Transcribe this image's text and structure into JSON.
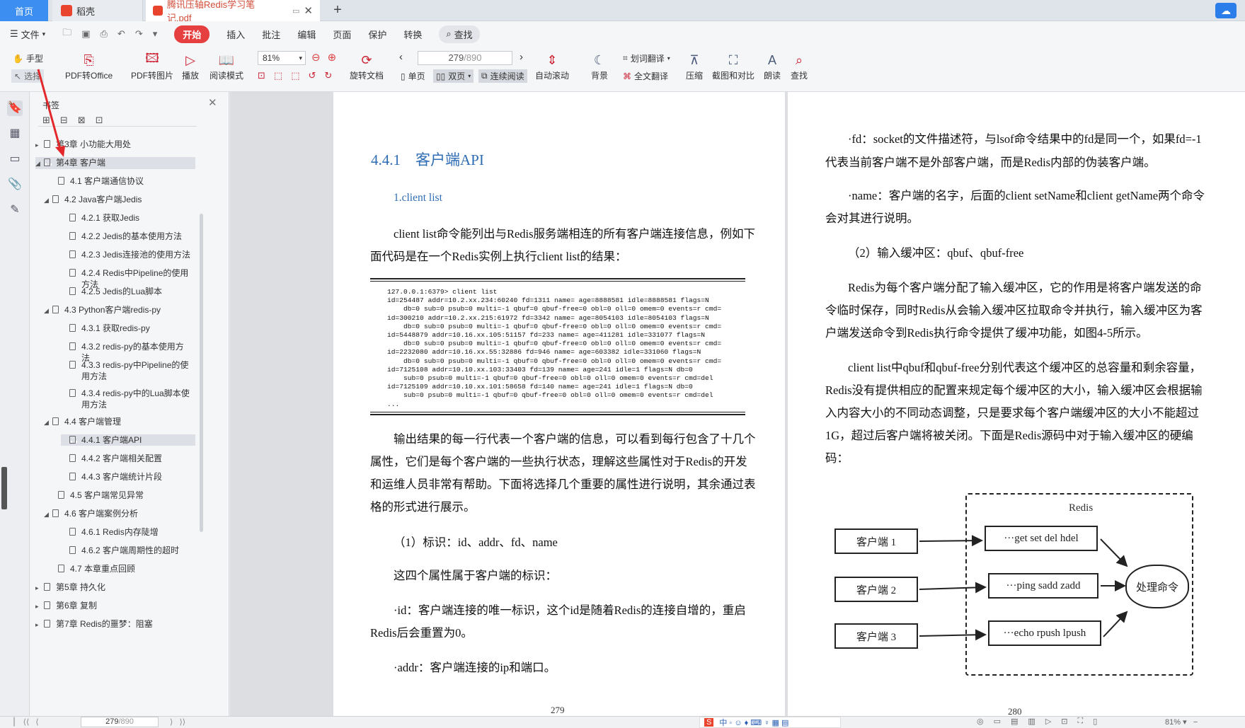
{
  "tabs": {
    "home": "首页",
    "daoke": "稻壳",
    "doc": "腾讯压轴Redis学习笔记.pdf"
  },
  "menu": [
    "文件",
    "开始",
    "插入",
    "批注",
    "编辑",
    "页面",
    "保护",
    "转换",
    "查找"
  ],
  "toolbar": {
    "hand": "手型",
    "select": "选择",
    "pdf_to_office": "PDF转Office",
    "pdf_to_image": "PDF转图片",
    "play": "播放",
    "read_mode": "阅读模式",
    "zoom": "81%",
    "rotate": "旋转文档",
    "page_input": "279",
    "page_total": "/890",
    "single": "单页",
    "double": "双页",
    "continuous": "连续阅读",
    "auto_scroll": "自动滚动",
    "background": "背景",
    "word_translate": "划词翻译",
    "full_translate": "全文翻译",
    "compress": "压缩",
    "screenshot_compare": "截图和对比",
    "read_aloud": "朗读",
    "find": "查找"
  },
  "panel": {
    "title": "书签",
    "items": [
      {
        "label": "第3章 小功能大用处",
        "level": 0,
        "arrow": "▶"
      },
      {
        "label": "第4章 客户端",
        "level": 0,
        "arrow": "◢"
      },
      {
        "label": "4.1 客户端通信协议",
        "level": 1,
        "arrow": ""
      },
      {
        "label": "4.2 Java客户端Jedis",
        "level": 1,
        "arrow": "◢"
      },
      {
        "label": "4.2.1 获取Jedis",
        "level": 2,
        "arrow": ""
      },
      {
        "label": "4.2.2 Jedis的基本使用方法",
        "level": 2,
        "arrow": ""
      },
      {
        "label": "4.2.3 Jedis连接池的使用方法",
        "level": 2,
        "arrow": ""
      },
      {
        "label": "4.2.4 Redis中Pipeline的使用方法",
        "level": 2,
        "arrow": ""
      },
      {
        "label": "4.2.5 Jedis的Lua脚本",
        "level": 2,
        "arrow": ""
      },
      {
        "label": "4.3 Python客户端redis-py",
        "level": 1,
        "arrow": "◢"
      },
      {
        "label": "4.3.1 获取redis-py",
        "level": 2,
        "arrow": ""
      },
      {
        "label": "4.3.2 redis-py的基本使用方法",
        "level": 2,
        "arrow": ""
      },
      {
        "label": "4.3.3 redis-py中Pipeline的使用方法",
        "level": 2,
        "arrow": ""
      },
      {
        "label": "4.3.4 redis-py中的Lua脚本使用方法",
        "level": 2,
        "arrow": ""
      },
      {
        "label": "4.4 客户端管理",
        "level": 1,
        "arrow": "◢"
      },
      {
        "label": "4.4.1 客户端API",
        "level": 2,
        "arrow": ""
      },
      {
        "label": "4.4.2 客户端相关配置",
        "level": 2,
        "arrow": ""
      },
      {
        "label": "4.4.3 客户端统计片段",
        "level": 2,
        "arrow": ""
      },
      {
        "label": "4.5 客户端常见异常",
        "level": 1,
        "arrow": ""
      },
      {
        "label": "4.6 客户端案例分析",
        "level": 1,
        "arrow": "◢"
      },
      {
        "label": "4.6.1 Redis内存陡增",
        "level": 2,
        "arrow": ""
      },
      {
        "label": "4.6.2 客户端周期性的超时",
        "level": 2,
        "arrow": ""
      },
      {
        "label": "4.7 本章重点回顾",
        "level": 1,
        "arrow": ""
      },
      {
        "label": "第5章 持久化",
        "level": 0,
        "arrow": "▶"
      },
      {
        "label": "第6章 复制",
        "level": 0,
        "arrow": "▶"
      },
      {
        "label": "第7章 Redis的噩梦：阻塞",
        "level": 0,
        "arrow": "▶"
      }
    ]
  },
  "left_page": {
    "heading": "4.4.1　客户端API",
    "subheading": "1.client list",
    "p1a": "client list命令能列出与Redis服务端相连的所有客户端连接信息，例如下",
    "p1b": "面代码是在一个Redis实例上执行client list的结果：",
    "code": "127.0.0.1:6379> client list\nid=254487 addr=10.2.xx.234:60240 fd=1311 name= age=8888581 idle=8888581 flags=N\n    db=0 sub=0 psub=0 multi=-1 qbuf=0 qbuf-free=0 obl=0 oll=0 omem=0 events=r cmd=\nid=300210 addr=10.2.xx.215:61972 fd=3342 name= age=8054103 idle=8054103 flags=N\n    db=0 sub=0 psub=0 multi=-1 qbuf=0 qbuf-free=0 obl=0 oll=0 omem=0 events=r cmd=\nid=5448879 addr=10.16.xx.105:51157 fd=233 name= age=411281 idle=331077 flags=N\n    db=0 sub=0 psub=0 multi=-1 qbuf=0 qbuf-free=0 obl=0 oll=0 omem=0 events=r cmd=\nid=2232080 addr=10.16.xx.55:32886 fd=946 name= age=603382 idle=331060 flags=N\n    db=0 sub=0 psub=0 multi=-1 qbuf=0 qbuf-free=0 obl=0 oll=0 omem=0 events=r cmd=\nid=7125108 addr=10.10.xx.103:33403 fd=139 name= age=241 idle=1 flags=N db=0\n    sub=0 psub=0 multi=-1 qbuf=0 qbuf-free=0 obl=0 oll=0 omem=0 events=r cmd=del\nid=7125109 addr=10.10.xx.101:58658 fd=140 name= age=241 idle=1 flags=N db=0\n    sub=0 psub=0 multi=-1 qbuf=0 qbuf-free=0 obl=0 oll=0 omem=0 events=r cmd=del\n...",
    "p2a": "输出结果的每一行代表一个客户端的信息，可以看到每行包含了十几个",
    "p2b": "属性，它们是每个客户端的一些执行状态，理解这些属性对于Redis的开发",
    "p2c": "和运维人员非常有帮助。下面将选择几个重要的属性进行说明，其余通过表",
    "p2d": "格的形式进行展示。",
    "p3": "（1）标识：id、addr、fd、name",
    "p4": "这四个属性属于客户端的标识：",
    "p5a": "·id：客户端连接的唯一标识，这个id是随着Redis的连接自增的，重启",
    "p5b": "Redis后会重置为0。",
    "p6": "·addr：客户端连接的ip和端口。",
    "page_num": "279"
  },
  "right_page": {
    "p1a": "·fd：socket的文件描述符，与lsof命令结果中的fd是同一个，如果fd=-1",
    "p1b": "代表当前客户端不是外部客户端，而是Redis内部的伪装客户端。",
    "p2a": "·name：客户端的名字，后面的client setName和client getName两个命令",
    "p2b": "会对其进行说明。",
    "p3": "（2）输入缓冲区：qbuf、qbuf-free",
    "p4a": "Redis为每个客户端分配了输入缓冲区，它的作用是将客户端发送的命",
    "p4b": "令临时保存，同时Redis从会输入缓冲区拉取命令并执行，输入缓冲区为客",
    "p4c": "户端发送命令到Redis执行命令提供了缓冲功能，如图4-5所示。",
    "p5a": "client list中qbuf和qbuf-free分别代表这个缓冲区的总容量和剩余容量，",
    "p5b": "Redis没有提供相应的配置来规定每个缓冲区的大小，输入缓冲区会根据输",
    "p5c": "入内容大小的不同动态调整，只是要求每个客户端缓冲区的大小不能超过",
    "p5d": "1G，超过后客户端将被关闭。下面是Redis源码中对于输入缓冲区的硬编",
    "p5e": "码：",
    "diagram": {
      "redis": "Redis",
      "client1": "客户端 1",
      "client2": "客户端 2",
      "client3": "客户端 3",
      "q1": "···get set del hdel",
      "q2": "···ping sadd zadd",
      "q3": "···echo rpush lpush",
      "process": "处理命令"
    },
    "page_num": "280"
  },
  "status": {
    "page_input": "279",
    "page_total": "/890",
    "zoom": "81%"
  }
}
